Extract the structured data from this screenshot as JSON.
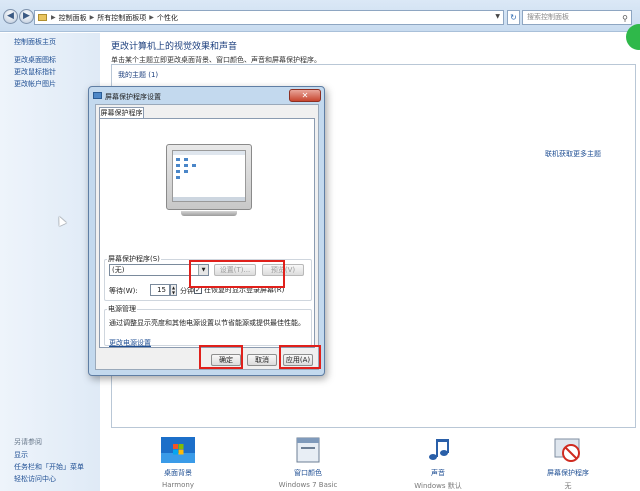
{
  "address_bar": {
    "crumbs": [
      "控制面板",
      "所有控制面板项",
      "个性化"
    ],
    "search_placeholder": "搜索控制面板"
  },
  "left_pane": {
    "home_link": "控制面板主页",
    "tasks": [
      "更改桌面图标",
      "更改鼠标指针",
      "更改帐户图片"
    ],
    "see_also_label": "另请参阅",
    "see_also": [
      "显示",
      "任务栏和「开始」菜单",
      "轻松访问中心"
    ]
  },
  "main": {
    "title": "更改计算机上的视觉效果和声音",
    "subtitle": "单击某个主题立即更改桌面背景、窗口颜色、声音和屏幕保护程序。",
    "my_themes": "我的主题 (1)",
    "online_link": "联机获取更多主题",
    "bottom_items": [
      {
        "name": "桌面背景",
        "sub": "Harmony"
      },
      {
        "name": "窗口颜色",
        "sub": "Windows 7 Basic"
      },
      {
        "name": "声音",
        "sub": "Windows 默认"
      },
      {
        "name": "屏幕保护程序",
        "sub": "无"
      }
    ]
  },
  "dialog": {
    "title": "屏幕保护程序设置",
    "close_glyph": "✕",
    "tab_label": "屏幕保护程序",
    "screensaver_group_label": "屏幕保护程序(S)",
    "screensaver_selected": "(无)",
    "settings_button": "设置(T)...",
    "preview_button": "预览(V)",
    "wait_label": "等待(W):",
    "wait_value": "15",
    "minute_label": "分钟",
    "resume_checkbox_label": "在恢复时显示登录屏幕(R)",
    "resume_checked": true,
    "power_group_label": "电源管理",
    "power_text": "通过调整显示亮度和其他电源设置以节省能源或提供最佳性能。",
    "power_link": "更改电源设置",
    "ok_button": "确定",
    "cancel_button": "取消",
    "apply_button": "应用(A)"
  },
  "icons": {
    "back": "◀",
    "forward": "▶",
    "dropdown": "▼",
    "refresh": "↻",
    "search": "⚲",
    "check": "✓",
    "spin_up": "▲",
    "spin_down": "▼"
  },
  "colors": {
    "link": "#1e4e93",
    "highlight": "#e0201b",
    "dialog_frame": "#c3d9ee"
  }
}
